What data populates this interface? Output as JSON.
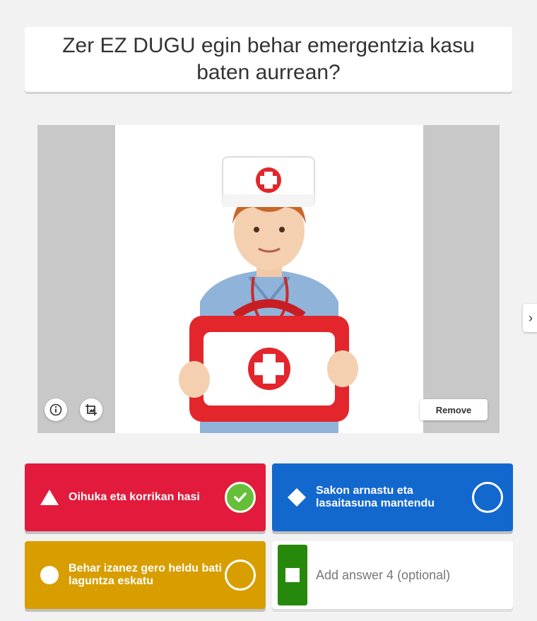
{
  "question": {
    "text": "Zer EZ DUGU egin behar emergentzia kasu baten aurrean?"
  },
  "media": {
    "info_icon": "info-icon",
    "crop_icon": "crop-icon",
    "remove_label": "Remove"
  },
  "navigation": {
    "next_icon": "chevron-right-icon",
    "next_glyph": "›"
  },
  "answers": [
    {
      "shape": "triangle",
      "color": "#e21b3c",
      "text": "Oihuka eta korrikan hasi",
      "correct": true
    },
    {
      "shape": "diamond",
      "color": "#1368ce",
      "text": "Sakon arnastu eta lasaitasuna mantendu",
      "correct": false
    },
    {
      "shape": "circle",
      "color": "#d89e00",
      "text": "Behar izanez gero heldu bati laguntza eskatu",
      "correct": false
    },
    {
      "shape": "square",
      "color": "#26890c",
      "placeholder": "Add answer 4 (optional)"
    }
  ]
}
